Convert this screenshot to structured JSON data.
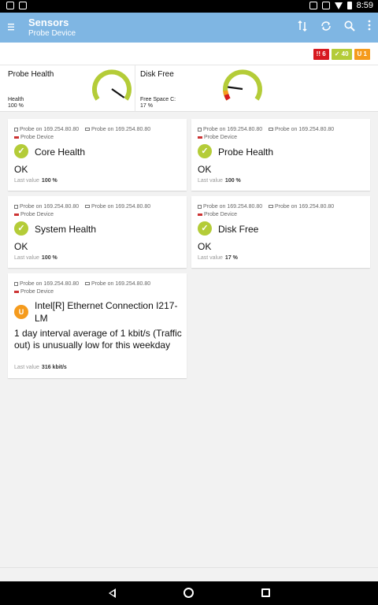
{
  "status_bar": {
    "time": "8:59"
  },
  "app_bar": {
    "title": "Sensors",
    "subtitle": "Probe Device",
    "icons": [
      "menu-icon",
      "sort-icon",
      "refresh-icon",
      "search-icon",
      "more-icon"
    ]
  },
  "badges": [
    {
      "symbol": "!!",
      "count": "6",
      "color": "#d71920"
    },
    {
      "symbol": "✓",
      "count": "40",
      "color": "#b4cc38"
    },
    {
      "symbol": "U",
      "count": "1",
      "color": "#f59b1d"
    }
  ],
  "gauges": [
    {
      "title": "Probe Health",
      "label": "Health",
      "value": "100 %",
      "percent": 100
    },
    {
      "title": "Disk Free",
      "label": "Free Space C:",
      "value": "17 %",
      "percent": 17
    }
  ],
  "cards": [
    {
      "crumb1": "Probe on 169.254.80.80",
      "crumb2": "Probe on 169.254.80.80",
      "device": "Probe Device",
      "status": "✓",
      "name": "Core Health",
      "message": "OK",
      "last_label": "Last value",
      "last_value": "100 %"
    },
    {
      "crumb1": "Probe on 169.254.80.80",
      "crumb2": "Probe on 169.254.80.80",
      "device": "Probe Device",
      "status": "✓",
      "name": "Probe Health",
      "message": "OK",
      "last_label": "Last value",
      "last_value": "100 %"
    },
    {
      "crumb1": "Probe on 169.254.80.80",
      "crumb2": "Probe on 169.254.80.80",
      "device": "Probe Device",
      "status": "✓",
      "name": "System Health",
      "message": "OK",
      "last_label": "Last value",
      "last_value": "100 %"
    },
    {
      "crumb1": "Probe on 169.254.80.80",
      "crumb2": "Probe on 169.254.80.80",
      "device": "Probe Device",
      "status": "✓",
      "name": "Disk Free",
      "message": "OK",
      "last_label": "Last value",
      "last_value": "17 %"
    },
    {
      "crumb1": "Probe on 169.254.80.80",
      "crumb2": "Probe on 169.254.80.80",
      "device": "Probe Device",
      "status": "U",
      "name": "Intel[R] Ethernet Connection I217-LM",
      "message": "1 day interval average of 1 kbit/s (Traffic out) is unusually low for this weekday",
      "last_label": "Last value",
      "last_value": "316 kbit/s"
    }
  ]
}
